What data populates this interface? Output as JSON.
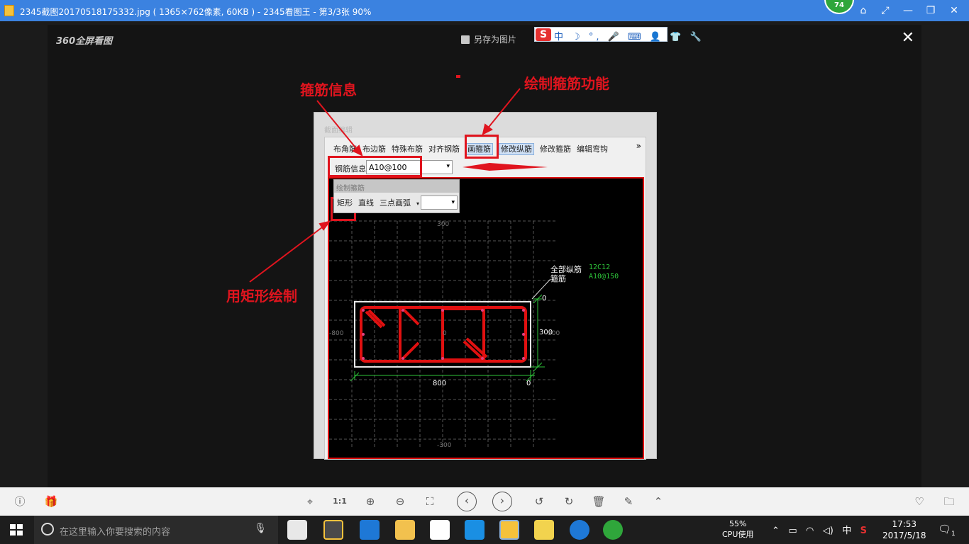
{
  "window": {
    "title": "2345截图20170518175332.jpg ( 1365×762像素, 60KB ) - 2345看图王 - 第3/3张 90%",
    "badge": "74"
  },
  "viewer": {
    "logo": "360全屏看图",
    "save_as": "另存为图片",
    "close": "✕"
  },
  "ime": {
    "logo": "S",
    "items": "中 ☽ °, 🎤 ⌨ 👤 👕 🔧"
  },
  "shot": {
    "frame_title": "截面编辑",
    "toolbar": [
      "布角筋",
      "布边筋",
      "特殊布筋",
      "对齐钢筋",
      "画箍筋",
      "修改纵筋",
      "修改箍筋",
      "编辑弯钩"
    ],
    "more": "»",
    "rebar_info_label": "钢筋信息",
    "rebar_info_value": "A10@100",
    "draw_panel": {
      "title": "绘制箍筋",
      "items": [
        "矩形",
        "直线",
        "三点画弧"
      ]
    },
    "canvas": {
      "top_label": "300",
      "bottom_label": "-300",
      "left_label": "-800",
      "right_label": "300",
      "center_label": "0",
      "all_longitudinal": "全部纵筋",
      "longitudinal_value": "12C12",
      "stirrup_label": "箍筋",
      "stirrup_value": "A10@150",
      "dim_width": "800",
      "dim_height": "300",
      "dim_zero_top": "0",
      "dim_zero_bottom": "0"
    }
  },
  "annotations": {
    "stirrup_info": "箍筋信息",
    "draw_stirrup": "绘制箍筋功能",
    "use_rectangle": "用矩形绘制"
  },
  "taskbar": {
    "search_placeholder": "在这里输入你要搜索的内容",
    "cpu_percent": "55%",
    "cpu_label": "CPU使用",
    "input_method": "中",
    "time": "17:53",
    "date": "2017/5/18",
    "notification_count": "1"
  },
  "colors": {
    "accent": "#3b82e0",
    "annotation": "#e0141e",
    "taskbar": "#1d1d1d"
  }
}
